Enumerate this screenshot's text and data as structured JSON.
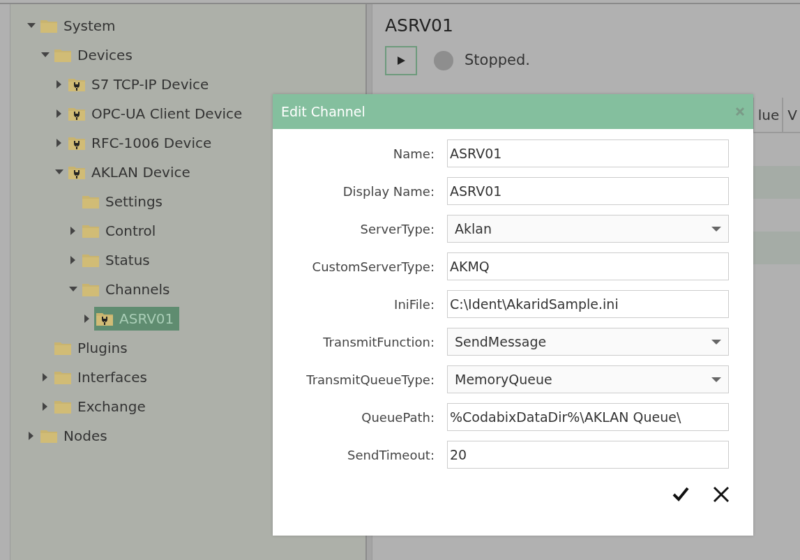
{
  "tree": [
    {
      "label": "System",
      "kind": "folder",
      "expanded": true,
      "selected": false,
      "children": [
        {
          "label": "Devices",
          "kind": "folder",
          "expanded": true,
          "selected": false,
          "children": [
            {
              "label": "S7 TCP-IP Device",
              "kind": "device",
              "expanded": false,
              "selected": false
            },
            {
              "label": "OPC-UA Client Device",
              "kind": "device",
              "expanded": false,
              "selected": false
            },
            {
              "label": "RFC-1006 Device",
              "kind": "device",
              "expanded": false,
              "selected": false
            },
            {
              "label": "AKLAN Device",
              "kind": "device",
              "expanded": true,
              "selected": false,
              "children": [
                {
                  "label": "Settings",
                  "kind": "folder",
                  "selected": false
                },
                {
                  "label": "Control",
                  "kind": "folder",
                  "expanded": false,
                  "selected": false
                },
                {
                  "label": "Status",
                  "kind": "folder",
                  "expanded": false,
                  "selected": false
                },
                {
                  "label": "Channels",
                  "kind": "folder",
                  "expanded": true,
                  "selected": false,
                  "children": [
                    {
                      "label": "ASRV01",
                      "kind": "device",
                      "expanded": false,
                      "selected": true
                    }
                  ]
                }
              ]
            }
          ]
        },
        {
          "label": "Plugins",
          "kind": "folder",
          "selected": false
        },
        {
          "label": "Interfaces",
          "kind": "folder",
          "expanded": false,
          "selected": false
        },
        {
          "label": "Exchange",
          "kind": "folder",
          "expanded": false,
          "selected": false
        }
      ]
    },
    {
      "label": "Nodes",
      "kind": "folder",
      "expanded": false,
      "selected": false
    }
  ],
  "detail": {
    "title": "ASRV01",
    "running": false,
    "status_text": "Stopped."
  },
  "table": {
    "columns": [
      "lue",
      "V"
    ]
  },
  "dialog": {
    "title": "Edit Channel",
    "fields": [
      {
        "label": "Name:",
        "kind": "text",
        "value": "ASRV01"
      },
      {
        "label": "Display Name:",
        "kind": "text",
        "value": "ASRV01"
      },
      {
        "label": "ServerType:",
        "kind": "select",
        "value": "Aklan"
      },
      {
        "label": "CustomServerType:",
        "kind": "text",
        "value": "AKMQ"
      },
      {
        "label": "IniFile:",
        "kind": "text",
        "value": "C:\\Ident\\AkaridSample.ini"
      },
      {
        "label": "TransmitFunction:",
        "kind": "select",
        "value": "SendMessage"
      },
      {
        "label": "TransmitQueueType:",
        "kind": "select",
        "value": "MemoryQueue"
      },
      {
        "label": "QueuePath:",
        "kind": "text",
        "value": "%CodabixDataDir%\\AKLAN Queue\\"
      },
      {
        "label": "SendTimeout:",
        "kind": "text",
        "value": "20"
      }
    ]
  }
}
